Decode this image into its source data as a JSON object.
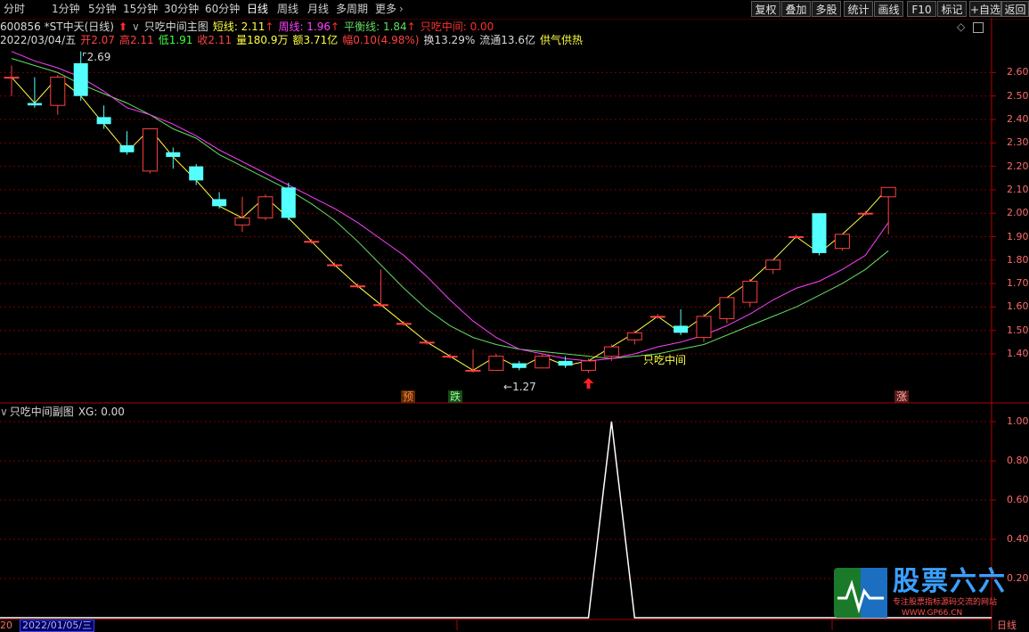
{
  "toolbar": {
    "tabs": [
      "分时",
      "1分钟",
      "5分钟",
      "15分钟",
      "30分钟",
      "60分钟",
      "日线",
      "周线",
      "月线",
      "多周期",
      "更多"
    ],
    "active_tab": "日线",
    "buttons": [
      "复权",
      "叠加",
      "多股",
      "统计",
      "画线",
      "F10",
      "标记",
      "+自选",
      "返回"
    ]
  },
  "header": {
    "code_name": "600856 *ST中天(日线)",
    "indicator_name": "只吃中间主图",
    "short_label": "短线: 2.11",
    "week_label": "周线: 1.96",
    "balance_label": "平衡线: 1.84",
    "zczj_label": "只吃中间: 0.00"
  },
  "quote": {
    "date": "2022/03/04/五",
    "open": "开2.07",
    "high": "高2.11",
    "low": "低1.91",
    "close": "收2.11",
    "volume": "量180.9万",
    "amount": "额3.71亿",
    "change": "幅0.10(4.98%)",
    "turnover": "换13.29%",
    "float_cap": "流通13.6亿",
    "tag": "供气供热"
  },
  "sub_header": {
    "title": "只吃中间副图",
    "xg": "XG: 0.00"
  },
  "annotations": {
    "high_label": "2.69",
    "low_label": "1.27",
    "signal_text": "只吃中间",
    "mark_yu": "预",
    "mark_die": "跌",
    "mark_zhang": "涨"
  },
  "footer": {
    "date_left": "2022/01/05/三",
    "period": "日线",
    "brand": "股票六六",
    "slogan": "专注股票指标源码交流的网站",
    "url": "WWW.GP66.CN"
  },
  "colors": {
    "up": "#ff4040",
    "down": "#54ffff",
    "short_line": "#ffff40",
    "week_line": "#ff40ff",
    "balance_line": "#64dc64",
    "grid": "#7a0000"
  },
  "chart_data": [
    {
      "type": "candlestick",
      "title": "只吃中间主图",
      "ylim": [
        1.27,
        2.69
      ],
      "yticks": [
        1.4,
        1.5,
        1.6,
        1.7,
        1.8,
        1.9,
        2.0,
        2.1,
        2.2,
        2.3,
        2.4,
        2.5,
        2.6
      ],
      "candles": [
        {
          "o": 2.58,
          "h": 2.63,
          "l": 2.5,
          "c": 2.58
        },
        {
          "o": 2.47,
          "h": 2.58,
          "l": 2.45,
          "c": 2.46
        },
        {
          "o": 2.46,
          "h": 2.59,
          "l": 2.42,
          "c": 2.58
        },
        {
          "o": 2.64,
          "h": 2.69,
          "l": 2.48,
          "c": 2.5
        },
        {
          "o": 2.41,
          "h": 2.46,
          "l": 2.36,
          "c": 2.38
        },
        {
          "o": 2.29,
          "h": 2.35,
          "l": 2.25,
          "c": 2.26
        },
        {
          "o": 2.18,
          "h": 2.36,
          "l": 2.17,
          "c": 2.36
        },
        {
          "o": 2.26,
          "h": 2.28,
          "l": 2.19,
          "c": 2.24
        },
        {
          "o": 2.2,
          "h": 2.21,
          "l": 2.12,
          "c": 2.14
        },
        {
          "o": 2.06,
          "h": 2.09,
          "l": 2.02,
          "c": 2.03
        },
        {
          "o": 1.95,
          "h": 2.07,
          "l": 1.92,
          "c": 1.98
        },
        {
          "o": 1.98,
          "h": 2.08,
          "l": 1.97,
          "c": 2.07
        },
        {
          "o": 2.11,
          "h": 2.13,
          "l": 1.97,
          "c": 1.98
        },
        {
          "o": 1.88,
          "h": 1.89,
          "l": 1.87,
          "c": 1.88
        },
        {
          "o": 1.78,
          "h": 1.79,
          "l": 1.77,
          "c": 1.78
        },
        {
          "o": 1.69,
          "h": 1.7,
          "l": 1.68,
          "c": 1.69
        },
        {
          "o": 1.61,
          "h": 1.76,
          "l": 1.6,
          "c": 1.61
        },
        {
          "o": 1.53,
          "h": 1.54,
          "l": 1.52,
          "c": 1.53
        },
        {
          "o": 1.45,
          "h": 1.46,
          "l": 1.44,
          "c": 1.45
        },
        {
          "o": 1.39,
          "h": 1.4,
          "l": 1.38,
          "c": 1.39
        },
        {
          "o": 1.33,
          "h": 1.42,
          "l": 1.32,
          "c": 1.33
        },
        {
          "o": 1.33,
          "h": 1.4,
          "l": 1.33,
          "c": 1.39
        },
        {
          "o": 1.36,
          "h": 1.37,
          "l": 1.33,
          "c": 1.34
        },
        {
          "o": 1.34,
          "h": 1.4,
          "l": 1.34,
          "c": 1.39
        },
        {
          "o": 1.37,
          "h": 1.39,
          "l": 1.34,
          "c": 1.35
        },
        {
          "o": 1.33,
          "h": 1.38,
          "l": 1.32,
          "c": 1.37
        },
        {
          "o": 1.39,
          "h": 1.44,
          "l": 1.37,
          "c": 1.43
        },
        {
          "o": 1.46,
          "h": 1.5,
          "l": 1.44,
          "c": 1.49
        },
        {
          "o": 1.56,
          "h": 1.57,
          "l": 1.55,
          "c": 1.56
        },
        {
          "o": 1.52,
          "h": 1.59,
          "l": 1.48,
          "c": 1.49
        },
        {
          "o": 1.47,
          "h": 1.57,
          "l": 1.45,
          "c": 1.56
        },
        {
          "o": 1.55,
          "h": 1.64,
          "l": 1.53,
          "c": 1.64
        },
        {
          "o": 1.62,
          "h": 1.72,
          "l": 1.6,
          "c": 1.71
        },
        {
          "o": 1.76,
          "h": 1.8,
          "l": 1.74,
          "c": 1.8
        },
        {
          "o": 1.9,
          "h": 1.91,
          "l": 1.89,
          "c": 1.9
        },
        {
          "o": 2.0,
          "h": 2.0,
          "l": 1.82,
          "c": 1.83
        },
        {
          "o": 1.85,
          "h": 1.91,
          "l": 1.84,
          "c": 1.91
        },
        {
          "o": 2.0,
          "h": 2.01,
          "l": 1.99,
          "c": 2.0
        },
        {
          "o": 2.07,
          "h": 2.11,
          "l": 1.91,
          "c": 2.11
        }
      ],
      "short_line": [
        2.58,
        2.47,
        2.58,
        2.5,
        2.38,
        2.26,
        2.36,
        2.24,
        2.14,
        2.03,
        1.98,
        2.07,
        1.98,
        1.88,
        1.78,
        1.69,
        1.61,
        1.53,
        1.45,
        1.39,
        1.33,
        1.39,
        1.34,
        1.39,
        1.35,
        1.37,
        1.43,
        1.49,
        1.56,
        1.49,
        1.56,
        1.64,
        1.71,
        1.8,
        1.9,
        1.83,
        1.91,
        2.0,
        2.11
      ],
      "week_line": [
        2.69,
        2.65,
        2.62,
        2.58,
        2.52,
        2.45,
        2.42,
        2.38,
        2.33,
        2.27,
        2.22,
        2.17,
        2.12,
        2.07,
        2.02,
        1.96,
        1.89,
        1.82,
        1.73,
        1.63,
        1.54,
        1.47,
        1.42,
        1.4,
        1.38,
        1.37,
        1.38,
        1.4,
        1.43,
        1.45,
        1.48,
        1.52,
        1.57,
        1.63,
        1.68,
        1.71,
        1.76,
        1.82,
        1.96
      ],
      "balance_line": [
        2.66,
        2.63,
        2.6,
        2.55,
        2.51,
        2.47,
        2.42,
        2.36,
        2.32,
        2.25,
        2.2,
        2.15,
        2.1,
        2.04,
        1.97,
        1.88,
        1.78,
        1.68,
        1.59,
        1.52,
        1.47,
        1.44,
        1.42,
        1.41,
        1.4,
        1.39,
        1.38,
        1.39,
        1.4,
        1.42,
        1.44,
        1.48,
        1.52,
        1.56,
        1.6,
        1.65,
        1.7,
        1.76,
        1.84
      ],
      "signal_up_index": 25
    },
    {
      "type": "line",
      "title": "只吃中间副图",
      "ylim": [
        0,
        1.0
      ],
      "yticks": [
        0.2,
        0.4,
        0.6,
        0.8,
        1.0
      ],
      "values": [
        0,
        0,
        0,
        0,
        0,
        0,
        0,
        0,
        0,
        0,
        0,
        0,
        0,
        0,
        0,
        0,
        0,
        0,
        0,
        0,
        0,
        0,
        0,
        0,
        0,
        0,
        1,
        0,
        0,
        0,
        0,
        0,
        0,
        0,
        0,
        0,
        0,
        0,
        0
      ]
    }
  ]
}
